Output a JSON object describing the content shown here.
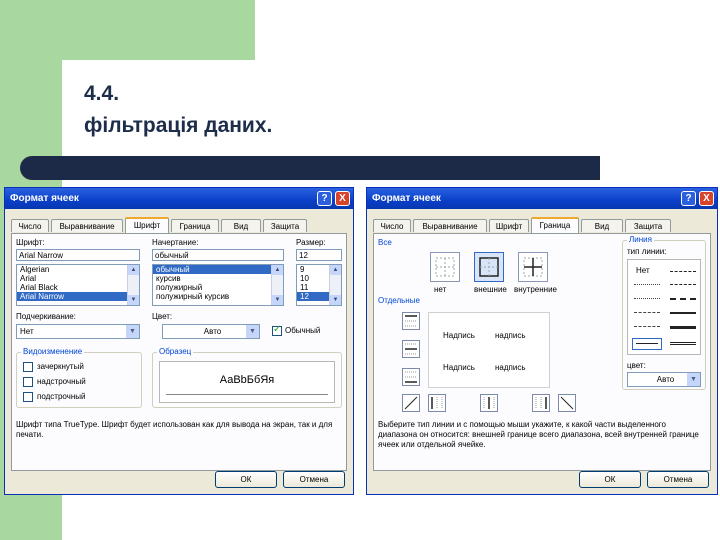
{
  "slide": {
    "title_line1": "4.4.",
    "title_line2": "фільтрація даних.",
    "accent_green": "#a8d8a0",
    "bar_color": "#1c2a48"
  },
  "dialog_left": {
    "title": "Формат ячеек",
    "help": "?",
    "close": "X",
    "tabs": [
      "Число",
      "Выравнивание",
      "Шрифт",
      "Граница",
      "Вид",
      "Защита"
    ],
    "active_tab": "Шрифт",
    "font_label": "Шрифт:",
    "font_value": "Arial Narrow",
    "font_list": [
      "Algerian",
      "Arial",
      "Arial Black",
      "Arial Narrow"
    ],
    "style_label": "Начертание:",
    "style_value": "обычный",
    "style_list": [
      "обычный",
      "курсив",
      "полужирный",
      "полужирный курсив"
    ],
    "size_label": "Размер:",
    "size_value": "12",
    "size_list": [
      "9",
      "10",
      "11",
      "12"
    ],
    "underline_label": "Подчеркивание:",
    "underline_value": "Нет",
    "color_label": "Цвет:",
    "color_value": "Авто",
    "normal_label": "Обычный",
    "effects_label": "Видоизменение",
    "effects": [
      "зачеркнутый",
      "надстрочный",
      "подстрочный"
    ],
    "sample_label": "Образец",
    "sample_text": "АаВbБбЯя",
    "note": "Шрифт типа TrueType. Шрифт будет использован как для вывода на экран, так и для печати.",
    "ok": "ОК",
    "cancel": "Отмена"
  },
  "dialog_right": {
    "title": "Формат ячеек",
    "help": "?",
    "close": "X",
    "tabs": [
      "Число",
      "Выравнивание",
      "Шрифт",
      "Граница",
      "Вид",
      "Защита"
    ],
    "active_tab": "Граница",
    "all_label": "Все",
    "presets": [
      "нет",
      "внешние",
      "внутренние"
    ],
    "separate_label": "Отдельные",
    "preview_text": [
      "Надпись",
      "надпись",
      "Надпись",
      "надпись"
    ],
    "line_label": "Линия",
    "type_label": "тип линии:",
    "none_label": "Нет",
    "color_label": "цвет:",
    "color_value": "Авто",
    "note": "Выберите тип линии и с помощью мыши укажите, к какой части выделенного диапазона он относится: внешней границе всего диапазона, всей внутренней границе ячеек или отдельной ячейке.",
    "ok": "ОК",
    "cancel": "Отмена"
  }
}
